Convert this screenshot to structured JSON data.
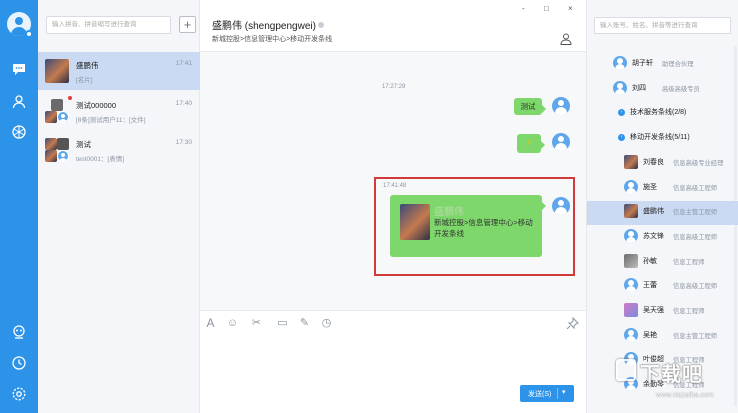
{
  "nav": {
    "items": [
      "chat-icon",
      "contacts-icon",
      "apps-icon"
    ],
    "bottom": [
      "robot-icon",
      "clock-icon",
      "settings-icon"
    ]
  },
  "sessions": {
    "search_placeholder": "输入拼音、拼音缩写进行查询",
    "add_label": "+",
    "items": [
      {
        "name": "盛鹏伟",
        "time": "17:41",
        "msg": "[名片]"
      },
      {
        "name": "测试000000",
        "time": "17:40",
        "msg": "[8条]测试用户11：[文件]"
      },
      {
        "name": "测试",
        "time": "17:30",
        "msg": "test0001：[表情]"
      }
    ]
  },
  "chat": {
    "title": "盛鹏伟 (shengpengwei)",
    "subtitle": "新城控股>信息管理中心>移动开发条线",
    "window_controls": [
      "-",
      "□",
      "×"
    ],
    "messages": [
      {
        "time": "17:27:29",
        "text": "测试"
      },
      {
        "text": "⚡"
      },
      {
        "time": "17:41:48",
        "card_name": "盛鹏伟",
        "card_path": "新城控股>信息管理中心>移动开发条线"
      }
    ],
    "toolbar": [
      "A",
      "☺",
      "✂",
      "▭",
      "✎",
      "◷"
    ],
    "send_label": "发送(S)",
    "send_arrow": "▾"
  },
  "contacts": {
    "search_placeholder": "输入账号、姓名、拼音等进行查询",
    "rows": [
      {
        "type": "person",
        "avatar": "default",
        "name": "胡子轩",
        "title": "助理合伙理"
      },
      {
        "type": "person",
        "avatar": "default",
        "name": "刘四",
        "title": "高级高级专员"
      },
      {
        "type": "group",
        "name": "技术服务条线(2/8)"
      },
      {
        "type": "group",
        "name": "移动开发条线(5/11)"
      },
      {
        "type": "person",
        "avatar": "photo",
        "name": "刘春良",
        "title": "信息高级专业经理"
      },
      {
        "type": "person",
        "avatar": "default",
        "name": "施圣",
        "title": "信息高级工程师"
      },
      {
        "type": "person",
        "avatar": "photo",
        "name": "盛鹏伟",
        "title": "信息主管工程师",
        "active": true
      },
      {
        "type": "person",
        "avatar": "default",
        "name": "苏文锋",
        "title": "信息高级工程师"
      },
      {
        "type": "person",
        "avatar": "gray",
        "name": "孙敏",
        "title": "信息工程师"
      },
      {
        "type": "person",
        "avatar": "default",
        "name": "王蕾",
        "title": "信息高级工程师"
      },
      {
        "type": "person",
        "avatar": "pink",
        "name": "吴天强",
        "title": "信息工程师"
      },
      {
        "type": "person",
        "avatar": "default",
        "name": "吴艳",
        "title": "信息主管工程师"
      },
      {
        "type": "person",
        "avatar": "default",
        "name": "叶俊超",
        "title": "信息工程师"
      },
      {
        "type": "person",
        "avatar": "default",
        "name": "余勤琴",
        "title": "信息工程师"
      }
    ]
  },
  "watermark": {
    "text": "下载吧",
    "url": "www.xiazaiba.com"
  }
}
